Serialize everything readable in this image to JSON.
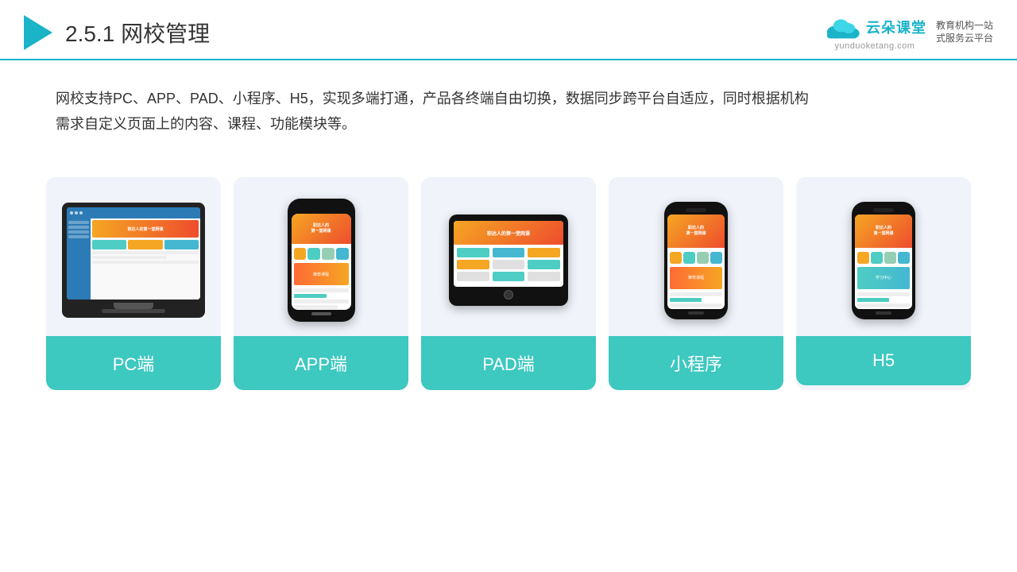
{
  "header": {
    "title_prefix": "2.5.1",
    "title_main": "网校管理",
    "logo": {
      "name": "云朵课堂",
      "url": "yunduoketang.com",
      "tagline": "教育机构一站\n式服务云平台"
    }
  },
  "description": {
    "text": "网校支持PC、APP、PAD、小程序、H5，实现多端打通，产品各终端自由切换，数据同步跨平台自适应，同时根据机构\n需求自定义页面上的内容、课程、功能模块等。"
  },
  "cards": [
    {
      "id": "pc",
      "label": "PC端",
      "type": "pc"
    },
    {
      "id": "app",
      "label": "APP端",
      "type": "phone"
    },
    {
      "id": "pad",
      "label": "PAD端",
      "type": "tablet"
    },
    {
      "id": "miniprogram",
      "label": "小程序",
      "type": "miniphone"
    },
    {
      "id": "h5",
      "label": "H5",
      "type": "miniphone2"
    }
  ],
  "colors": {
    "accent": "#1ab3c8",
    "card_bg": "#f0f4fa",
    "label_bg": "#3dc8c0"
  }
}
